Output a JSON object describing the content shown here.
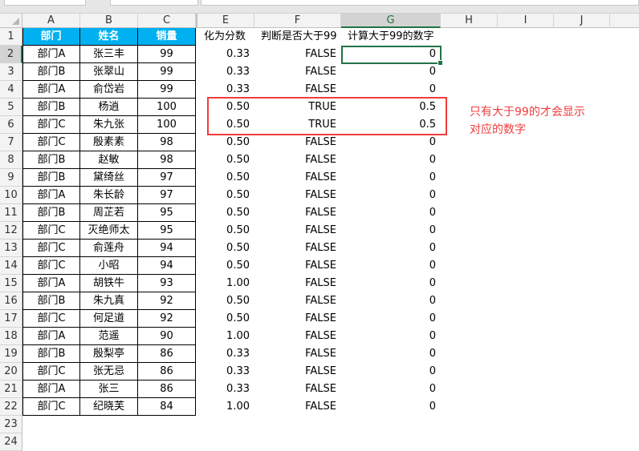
{
  "columns": [
    "A",
    "B",
    "C",
    "E",
    "F",
    "G",
    "H",
    "I",
    "J"
  ],
  "headers": {
    "dept": "部门",
    "name": "姓名",
    "sales": "销量",
    "fraction": "化为分数",
    "judge": "判断是否大于99",
    "calc": "计算大于99的数字"
  },
  "rows": [
    [
      "部门A",
      "张三丰",
      "99",
      "0.33",
      "FALSE",
      "0"
    ],
    [
      "部门B",
      "张翠山",
      "99",
      "0.33",
      "FALSE",
      "0"
    ],
    [
      "部门A",
      "俞岱岩",
      "99",
      "0.33",
      "FALSE",
      "0"
    ],
    [
      "部门B",
      "杨逍",
      "100",
      "0.50",
      "TRUE",
      "0.5"
    ],
    [
      "部门C",
      "朱九张",
      "100",
      "0.50",
      "TRUE",
      "0.5"
    ],
    [
      "部门C",
      "殷素素",
      "98",
      "0.50",
      "FALSE",
      "0"
    ],
    [
      "部门B",
      "赵敏",
      "98",
      "0.50",
      "FALSE",
      "0"
    ],
    [
      "部门B",
      "黛绮丝",
      "97",
      "0.50",
      "FALSE",
      "0"
    ],
    [
      "部门A",
      "朱长龄",
      "97",
      "0.50",
      "FALSE",
      "0"
    ],
    [
      "部门B",
      "周芷若",
      "95",
      "0.50",
      "FALSE",
      "0"
    ],
    [
      "部门C",
      "灭绝师太",
      "95",
      "0.50",
      "FALSE",
      "0"
    ],
    [
      "部门C",
      "俞莲舟",
      "94",
      "0.50",
      "FALSE",
      "0"
    ],
    [
      "部门C",
      "小昭",
      "94",
      "0.50",
      "FALSE",
      "0"
    ],
    [
      "部门A",
      "胡铁牛",
      "93",
      "1.00",
      "FALSE",
      "0"
    ],
    [
      "部门B",
      "朱九真",
      "92",
      "0.50",
      "FALSE",
      "0"
    ],
    [
      "部门C",
      "何足道",
      "92",
      "0.50",
      "FALSE",
      "0"
    ],
    [
      "部门A",
      "范遥",
      "90",
      "1.00",
      "FALSE",
      "0"
    ],
    [
      "部门B",
      "殷梨亭",
      "86",
      "0.33",
      "FALSE",
      "0"
    ],
    [
      "部门C",
      "张无忌",
      "86",
      "0.33",
      "FALSE",
      "0"
    ],
    [
      "部门A",
      "张三",
      "86",
      "0.33",
      "FALSE",
      "0"
    ],
    [
      "部门C",
      "纪晓芙",
      "84",
      "1.00",
      "FALSE",
      "0"
    ]
  ],
  "row_numbers": [
    "1",
    "2",
    "3",
    "4",
    "5",
    "6",
    "7",
    "8",
    "9",
    "10",
    "11",
    "12",
    "13",
    "14",
    "15",
    "16",
    "17",
    "18",
    "19",
    "20",
    "21",
    "22",
    "23",
    "24"
  ],
  "annotation": {
    "line1": "只有大于99的才会显示",
    "line2": "对应的数字"
  },
  "colors": {
    "header_fill": "#00b0f0",
    "annotation": "#f03c3c",
    "selection": "#217346"
  }
}
